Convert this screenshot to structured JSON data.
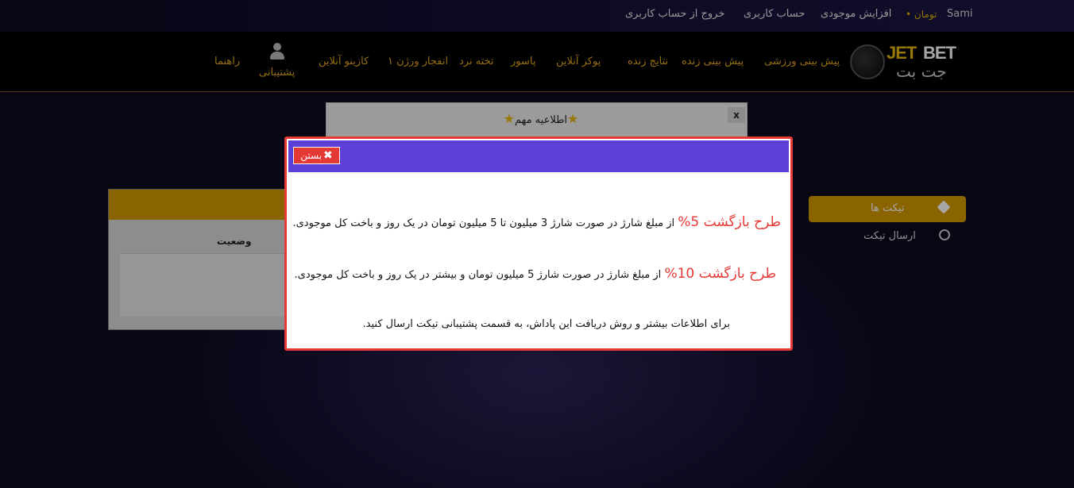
{
  "topbar": {
    "user": "Sami",
    "currency": "تومان •",
    "deposit": "افزایش موجودی",
    "account": "حساب کاربری",
    "logout": "خروج از حساب کاربری"
  },
  "logo": {
    "jet": "JET",
    "bet": "BET",
    "fa": "جت بت"
  },
  "nav": {
    "sport": "پیش بینی ورزشی",
    "live": "پیش بینی زنده",
    "results": "نتایج زنده",
    "poker": "پوکر آنلاین",
    "pasoor": "پاسور",
    "backgammon": "تخته نرد",
    "crash": "انفجار ورژن ۱",
    "casino": "کازینو آنلاین",
    "support": "پشتیبانی",
    "guide": "راهنما"
  },
  "notice": {
    "title": "اطلاعیه مهم",
    "close": "x"
  },
  "panel": {
    "status_header": "وضعیت"
  },
  "sidebar": {
    "tickets": "تیکت ها",
    "send_ticket": "ارسال تیکت"
  },
  "modal": {
    "close_label": "بستن",
    "line1_highlight": "طرح بازگشت 5%",
    "line1_text": " از مبلغ شارژ در صورت شارژ 3 میلیون تا 5 میلیون تومان در یک روز و باخت کل موجودی.",
    "line2_highlight": "طرح بازگشت 10%",
    "line2_text": " از مبلغ شارژ در صورت شارژ 5 میلیون تومان و بیشتر در یک روز و باخت کل موجودی.",
    "line3_text": "برای اطلاعات بیشتر و روش دریافت این پاداش، به قسمت پشتیبانی تیکت ارسال کنید."
  },
  "colors": {
    "accent_gold": "#d49a00",
    "modal_header": "#5b3fd6",
    "modal_border": "#e53935",
    "highlight_red": "#e53935"
  }
}
